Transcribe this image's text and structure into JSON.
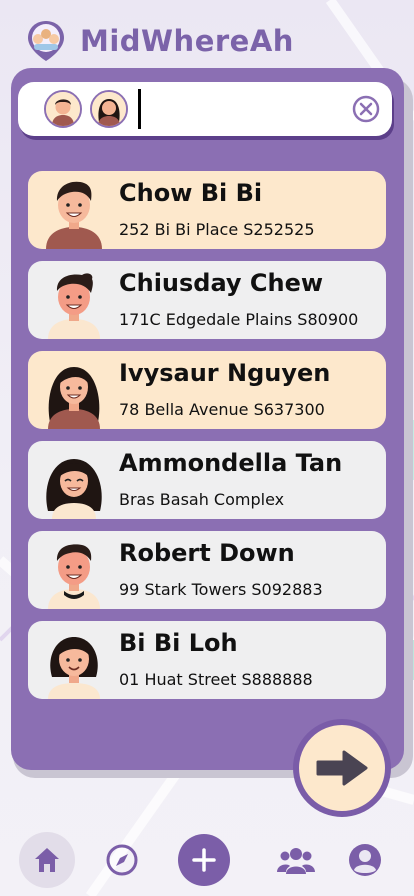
{
  "app": {
    "title": "MidWhereAh"
  },
  "search": {
    "selected": [
      "chow-bi-bi",
      "ivysaur-nguyen"
    ]
  },
  "contacts": [
    {
      "name": "Chow Bi Bi",
      "address": "252 Bi Bi Place S252525",
      "selected": true
    },
    {
      "name": "Chiusday Chew",
      "address": "171C Edgedale Plains S80900",
      "selected": false
    },
    {
      "name": "Ivysaur Nguyen",
      "address": "78 Bella Avenue S637300",
      "selected": true
    },
    {
      "name": "Ammondella Tan",
      "address": "Bras Basah Complex",
      "selected": false
    },
    {
      "name": "Robert Down",
      "address": "99 Stark Towers S092883",
      "selected": false
    },
    {
      "name": "Bi Bi Loh",
      "address": "01 Huat Street S888888",
      "selected": false
    }
  ],
  "colors": {
    "primary": "#8b6fb3",
    "accent": "#7a5ca8",
    "selected_card": "#fde8cc",
    "card": "#efeff0"
  },
  "nav": {
    "items": [
      "home-icon",
      "compass-icon",
      "add-icon",
      "group-icon",
      "profile-icon"
    ],
    "active": "home-icon"
  }
}
